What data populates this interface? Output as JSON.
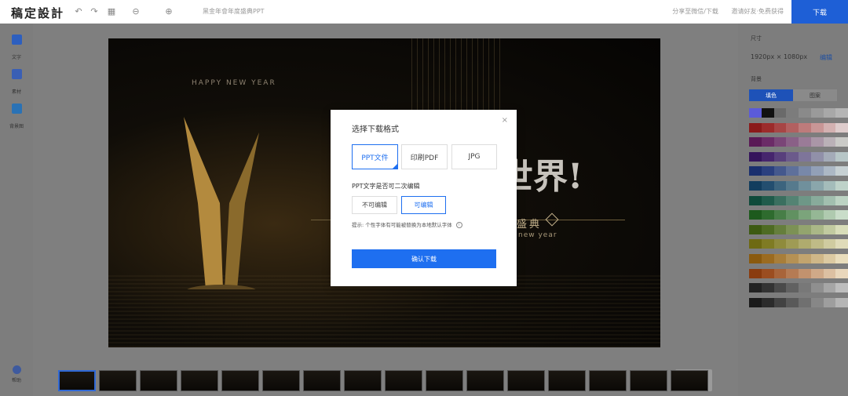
{
  "app": {
    "logo": "稿定設計",
    "doc_title": "黑金年會年度盛典PPT",
    "top_links": [
      "分享至微信/下载",
      "邀请好友·免费获得"
    ],
    "download_label": "下载"
  },
  "sidebar": {
    "items": [
      {
        "label": "文字",
        "icon": "text-icon",
        "color": "#2d5fbf"
      },
      {
        "label": "素材",
        "icon": "material-icon",
        "color": "#3a5fb5"
      },
      {
        "label": "背景图",
        "icon": "background-icon",
        "color": "#2a72b5"
      }
    ],
    "help_label": "帮助"
  },
  "slide": {
    "happy_new_year": "HAPPY NEW YEAR",
    "headline": "世界!",
    "subtitle": "盛典",
    "eng": "new year"
  },
  "right_panel": {
    "size_section": "尺寸",
    "size_value": "1920px × 1080px",
    "edit_label": "编辑",
    "background_section": "背景",
    "tabs": [
      "填色",
      "图案"
    ],
    "swatch_rows": [
      [
        "#5b5bd9",
        "#111111",
        "#6a6a6a",
        "#7c7c7c",
        "#8a8a8a",
        "#9a9a9a",
        "#a8a8a8",
        "#b5b5b5"
      ],
      [
        "#8b1a1a",
        "#9c2b2b",
        "#a74545",
        "#b26060",
        "#bd7b7b",
        "#c89696",
        "#d3b1b1",
        "#decccc"
      ],
      [
        "#5a1a56",
        "#6b2b67",
        "#7a4577",
        "#8a6087",
        "#9a7b97",
        "#aa96a7",
        "#bab1b7",
        "#cacac7"
      ],
      [
        "#35145c",
        "#46256d",
        "#583f7c",
        "#6b5a8b",
        "#7e759a",
        "#9190a9",
        "#a4abb8",
        "#b7c6c7"
      ],
      [
        "#1a2f6e",
        "#2b407f",
        "#44588d",
        "#5e709b",
        "#7888a9",
        "#92a0b7",
        "#acb8c5",
        "#c6d0d3"
      ],
      [
        "#123d5e",
        "#234e6f",
        "#3c647e",
        "#567a8d",
        "#70909c",
        "#8aa6ab",
        "#a4bcba",
        "#bed2c9"
      ],
      [
        "#0f4a3a",
        "#205b4b",
        "#3a6f5f",
        "#548373",
        "#6e9787",
        "#88ab9b",
        "#a2bfaf",
        "#bcd3c3"
      ],
      [
        "#1d5a1d",
        "#2e6b2e",
        "#477e47",
        "#619161",
        "#7ba47b",
        "#95b795",
        "#afcaaf",
        "#c9ddc9"
      ],
      [
        "#3d5a12",
        "#4e6b23",
        "#657e3c",
        "#7c9155",
        "#93a46e",
        "#aab787",
        "#c1caa0",
        "#d8ddb9"
      ],
      [
        "#6e6a12",
        "#7f7b23",
        "#8f8b3c",
        "#9f9b55",
        "#afab6e",
        "#bfbb87",
        "#cfcba0",
        "#dfdbb9"
      ],
      [
        "#8a5a0f",
        "#9b6b20",
        "#a87e3a",
        "#b59154",
        "#c2a46e",
        "#cfb788",
        "#dccaa2",
        "#e9ddbc"
      ],
      [
        "#8a3c0f",
        "#9b4d20",
        "#a8643a",
        "#b57b54",
        "#c2926e",
        "#cfa988",
        "#dcc0a2",
        "#e9d7bc"
      ],
      [
        "#222222",
        "#333333",
        "#4a4a4a",
        "#616161",
        "#787878",
        "#8f8f8f",
        "#a6a6a6",
        "#bdbdbd"
      ],
      [
        "#1a1a1a",
        "#2b2b2b",
        "#424242",
        "#595959",
        "#707070",
        "#878787",
        "#9e9e9e",
        "#b5b5b5"
      ]
    ]
  },
  "thumbnails": {
    "count": 16,
    "add_label": "+"
  },
  "modal": {
    "title": "选择下载格式",
    "close": "×",
    "formats": [
      "PPT文件",
      "印刷PDF",
      "JPG"
    ],
    "selected_format": "PPT文件",
    "question": "PPT文字是否可二次编辑",
    "edit_options": [
      "不可编辑",
      "可编辑"
    ],
    "selected_edit": "可编辑",
    "hint": "提示: 个性字体有可能被替换为本地默认字体",
    "info_icon": "i",
    "confirm_label": "确认下载"
  }
}
